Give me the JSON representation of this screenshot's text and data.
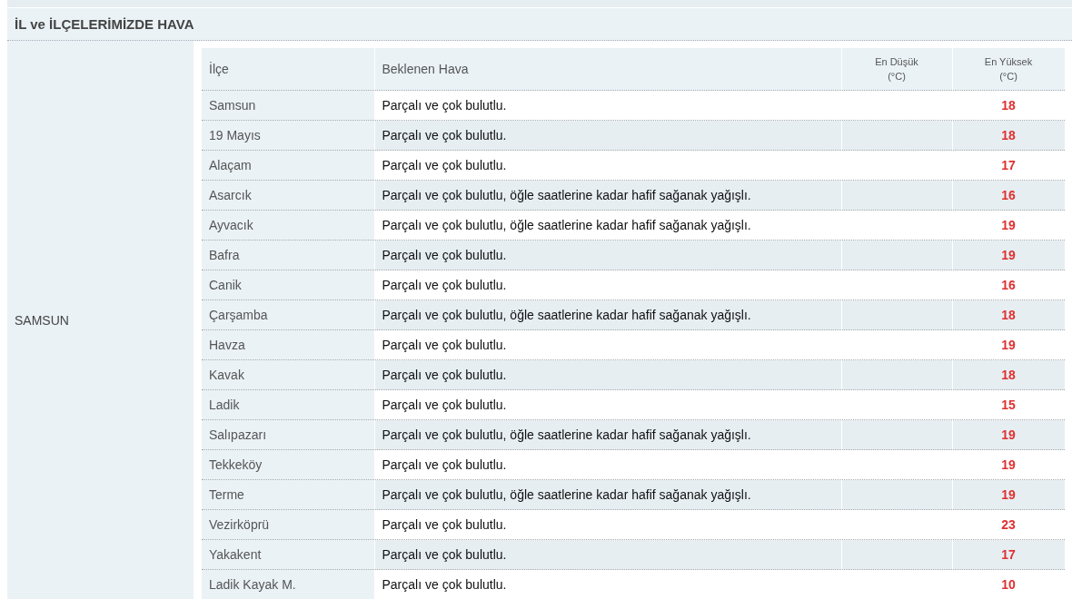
{
  "section_title": "İL ve İLÇELERİMİZDE HAVA",
  "province": "SAMSUN",
  "table": {
    "columns": [
      {
        "label": "İlçe"
      },
      {
        "label": "Beklenen Hava"
      },
      {
        "label": "En Düşük",
        "unit": "(°C)"
      },
      {
        "label": "En Yüksek",
        "unit": "(°C)"
      }
    ],
    "rows": [
      {
        "district": "Samsun",
        "forecast": "Parçalı ve çok bulutlu.",
        "max": "18"
      },
      {
        "district": "19 Mayıs",
        "forecast": "Parçalı ve çok bulutlu.",
        "max": "18"
      },
      {
        "district": "Alaçam",
        "forecast": "Parçalı ve çok bulutlu.",
        "max": "17"
      },
      {
        "district": "Asarcık",
        "forecast": "Parçalı ve çok bulutlu, öğle saatlerine kadar hafif sağanak yağışlı.",
        "max": "16"
      },
      {
        "district": "Ayvacık",
        "forecast": "Parçalı ve çok bulutlu, öğle saatlerine kadar hafif sağanak yağışlı.",
        "max": "19"
      },
      {
        "district": "Bafra",
        "forecast": "Parçalı ve çok bulutlu.",
        "max": "19"
      },
      {
        "district": "Canik",
        "forecast": "Parçalı ve çok bulutlu.",
        "max": "16"
      },
      {
        "district": "Çarşamba",
        "forecast": "Parçalı ve çok bulutlu, öğle saatlerine kadar hafif sağanak yağışlı.",
        "max": "18"
      },
      {
        "district": "Havza",
        "forecast": "Parçalı ve çok bulutlu.",
        "max": "19"
      },
      {
        "district": "Kavak",
        "forecast": "Parçalı ve çok bulutlu.",
        "max": "18"
      },
      {
        "district": "Ladik",
        "forecast": "Parçalı ve çok bulutlu.",
        "max": "15"
      },
      {
        "district": "Salıpazarı",
        "forecast": "Parçalı ve çok bulutlu, öğle saatlerine kadar hafif sağanak yağışlı.",
        "max": "19"
      },
      {
        "district": "Tekkeköy",
        "forecast": "Parçalı ve çok bulutlu.",
        "max": "19"
      },
      {
        "district": "Terme",
        "forecast": "Parçalı ve çok bulutlu, öğle saatlerine kadar hafif sağanak yağışlı.",
        "max": "19"
      },
      {
        "district": "Vezirköprü",
        "forecast": "Parçalı ve çok bulutlu.",
        "max": "23"
      },
      {
        "district": "Yakakent",
        "forecast": "Parçalı ve çok bulutlu.",
        "max": "17"
      },
      {
        "district": "Ladik Kayak M.",
        "forecast": "Parçalı ve çok bulutlu.",
        "max": "10"
      }
    ]
  }
}
